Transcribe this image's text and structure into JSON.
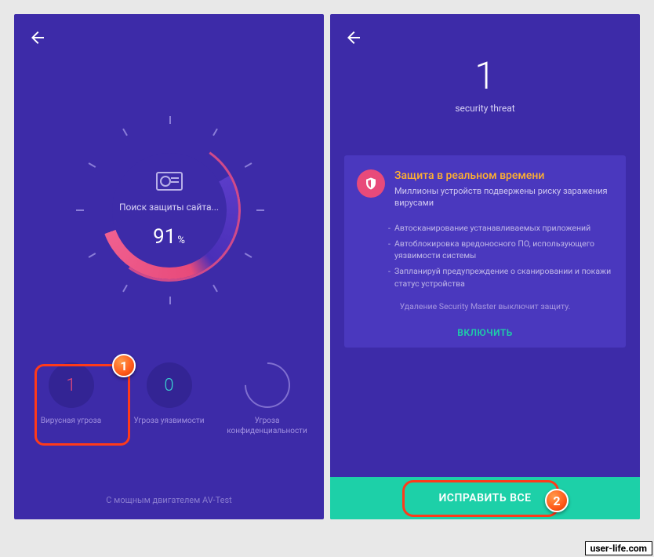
{
  "left": {
    "scan_status": "Поиск защиты сайта...",
    "progress_value": "91",
    "progress_sign": "%",
    "threats": {
      "virus": {
        "count": "1",
        "label": "Вирусная угроза"
      },
      "vuln": {
        "count": "0",
        "label": "Угроза уязвимости"
      },
      "priv": {
        "label": "Угроза конфиденциальности"
      }
    },
    "footer": "С мощным двигателем AV-Test"
  },
  "right": {
    "count": "1",
    "subtitle": "security threat",
    "card": {
      "title": "Защита в реальном времени",
      "subtitle": "Миллионы устройств подвержены риску заражения вирусами",
      "items": [
        "Автосканирование устанавливаемых приложений",
        "Автоблокировка вредоносного ПО, использующего уязвимости системы",
        "Запланируй предупреждение о сканировании и покажи статус устройства"
      ],
      "warning": "Удаление Security Master выключит защиту.",
      "action": "ВКЛЮЧИТЬ"
    },
    "fix_button": "ИСПРАВИТЬ ВСЕ"
  },
  "annotations": {
    "badge1": "1",
    "badge2": "2"
  },
  "watermark": "user-life.com"
}
